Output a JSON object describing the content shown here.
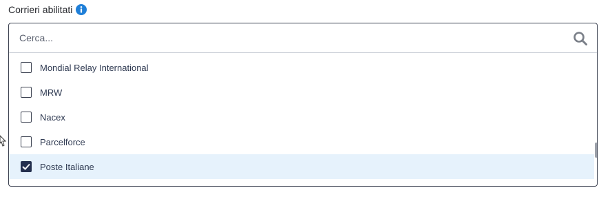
{
  "field": {
    "label": "Corrieri abilitati",
    "info_icon": "info-icon",
    "accent_color": "#1f7fd8"
  },
  "search": {
    "placeholder": "Cerca...",
    "value": "",
    "icon": "search-icon"
  },
  "carriers": [
    {
      "label": "Mondial Relay International",
      "checked": false
    },
    {
      "label": "MRW",
      "checked": false
    },
    {
      "label": "Nacex",
      "checked": false
    },
    {
      "label": "Parcelforce",
      "checked": false
    },
    {
      "label": "Poste Italiane",
      "checked": true
    },
    {
      "label": "",
      "checked": false
    }
  ],
  "colors": {
    "selected_row_bg": "#e6f2fc",
    "checkbox_checked": "#24304e",
    "border": "#3b4150"
  }
}
